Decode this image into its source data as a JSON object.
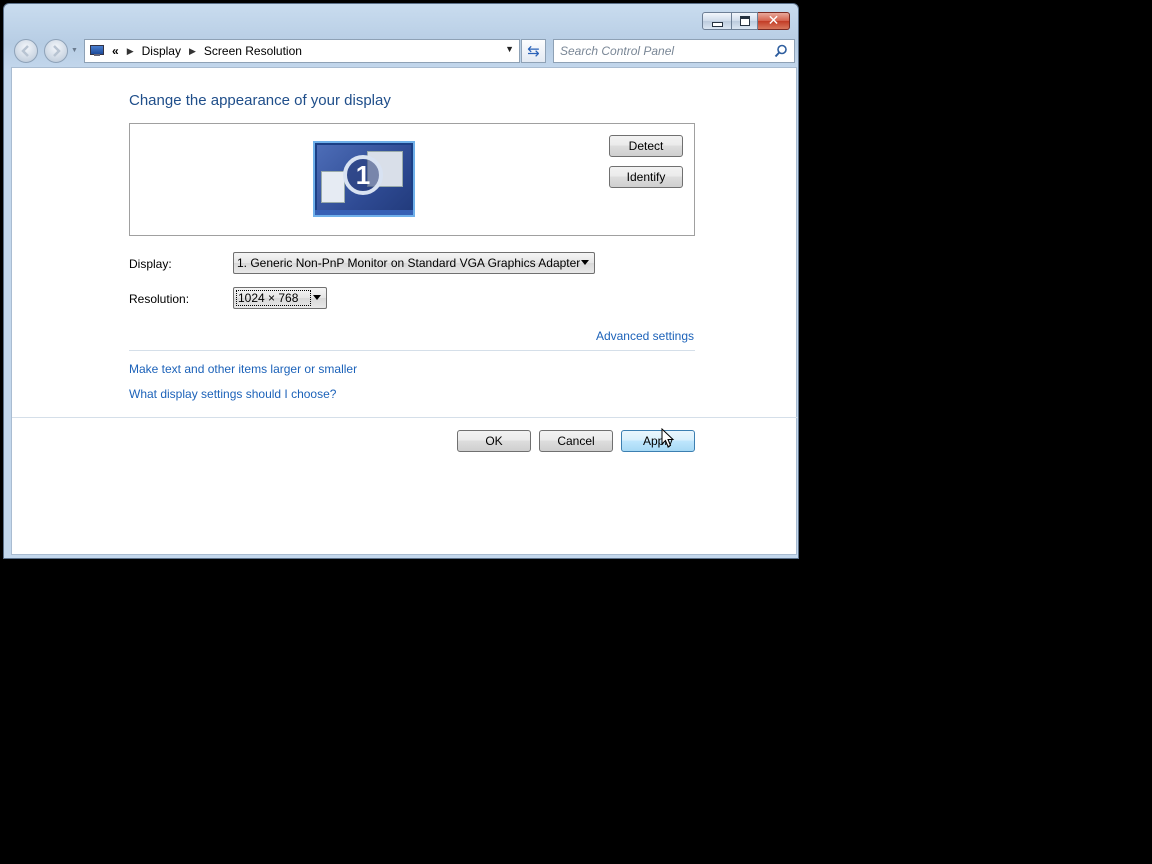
{
  "window": {
    "controls": {
      "minimize": "minimize",
      "maximize": "maximize",
      "close": "close"
    }
  },
  "addressbar": {
    "overflow": "«",
    "breadcrumbs": [
      {
        "label": "Display"
      },
      {
        "label": "Screen Resolution"
      }
    ]
  },
  "search": {
    "placeholder": "Search Control Panel"
  },
  "main": {
    "title": "Change the appearance of your display",
    "monitor_number": "1",
    "detect_label": "Detect",
    "identify_label": "Identify",
    "display_label": "Display:",
    "display_value": "1. Generic Non-PnP Monitor on Standard VGA Graphics Adapter",
    "resolution_label": "Resolution:",
    "resolution_value": "1024 × 768",
    "advanced_settings": "Advanced settings",
    "larger_text_link": "Make text and other items larger or smaller",
    "which_settings_link": "What display settings should I choose?"
  },
  "footer": {
    "ok_label": "OK",
    "cancel_label": "Cancel",
    "apply_label": "Apply"
  },
  "icons": {
    "back": "back-arrow-icon",
    "forward": "forward-arrow-icon",
    "refresh": "refresh-icon",
    "search": "search-icon"
  },
  "colors": {
    "title": "#1f4e8a",
    "link": "#1c62b9",
    "close_button": "#c23c26",
    "default_button": "#bee6fd"
  }
}
